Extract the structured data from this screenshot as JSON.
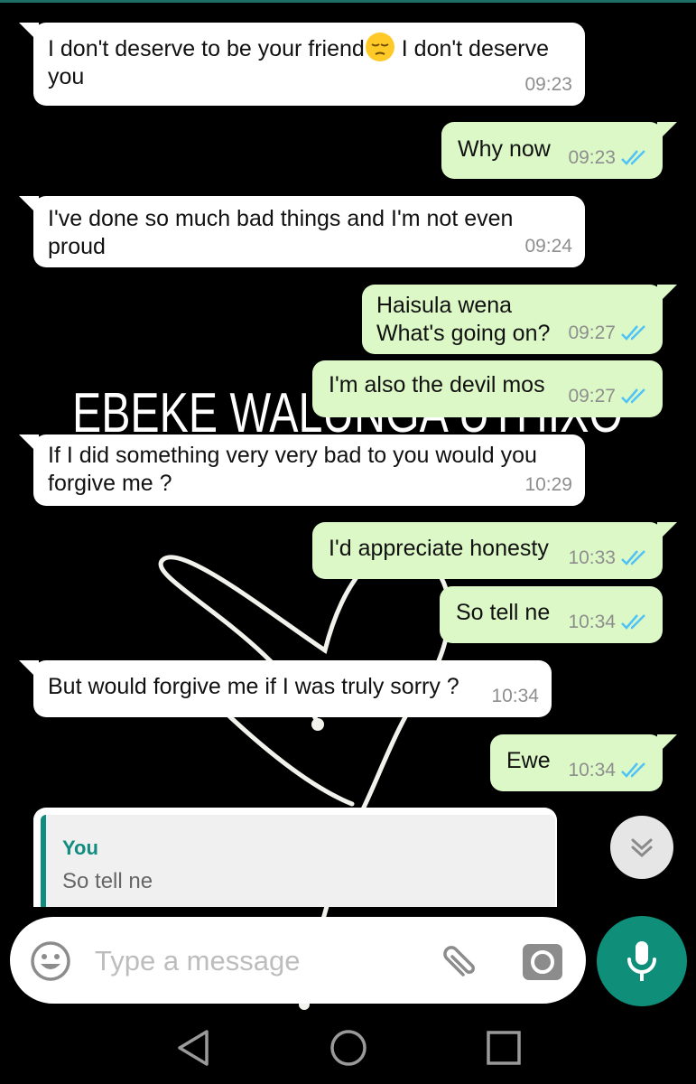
{
  "wallpaper": {
    "watermark_text": "EBEKE WALUNGA UTHIXO"
  },
  "messages": [
    {
      "dir": "in",
      "text_a": "I don't deserve to be your friend",
      "emoji": "pensive-face",
      "text_b": " I don't deserve\nyou",
      "time": "09:23"
    },
    {
      "dir": "out",
      "text": "Why now",
      "time": "09:23",
      "status": "read"
    },
    {
      "dir": "in",
      "text": "I've done so much bad things and I'm not even\nproud",
      "time": "09:24"
    },
    {
      "dir": "out",
      "text": "Haisula wena\nWhat's going on?",
      "time": "09:27",
      "status": "read"
    },
    {
      "dir": "out",
      "text": "I'm also the devil mos",
      "time": "09:27",
      "status": "read"
    },
    {
      "dir": "in",
      "text": "If I did something very very bad to you would you\nforgive me ?",
      "time": "10:29"
    },
    {
      "dir": "out",
      "text": "I'd appreciate honesty",
      "time": "10:33",
      "status": "read"
    },
    {
      "dir": "out",
      "text": "So tell ne",
      "time": "10:34",
      "status": "read"
    },
    {
      "dir": "in",
      "text": "But would forgive me if I was truly sorry ?",
      "time": "10:34"
    },
    {
      "dir": "out",
      "text": "Ewe",
      "time": "10:34",
      "status": "read"
    }
  ],
  "reply_preview": {
    "sender": "You",
    "text": "So tell ne"
  },
  "composer": {
    "placeholder": "Type a message",
    "value": ""
  },
  "icons": {
    "emoji": "smiley-icon",
    "attach": "paperclip-icon",
    "camera": "camera-icon",
    "mic": "mic-icon",
    "scroll": "double-chevron-down-icon",
    "nav_back": "triangle-back-icon",
    "nav_home": "circle-home-icon",
    "nav_recents": "square-recents-icon"
  },
  "colors": {
    "outgoing_bubble": "#dcf8c6",
    "incoming_bubble": "#ffffff",
    "accent": "#128c7e",
    "read_ticks": "#4fc3f7",
    "mic_button": "#0f8f7a",
    "background": "#000000"
  }
}
